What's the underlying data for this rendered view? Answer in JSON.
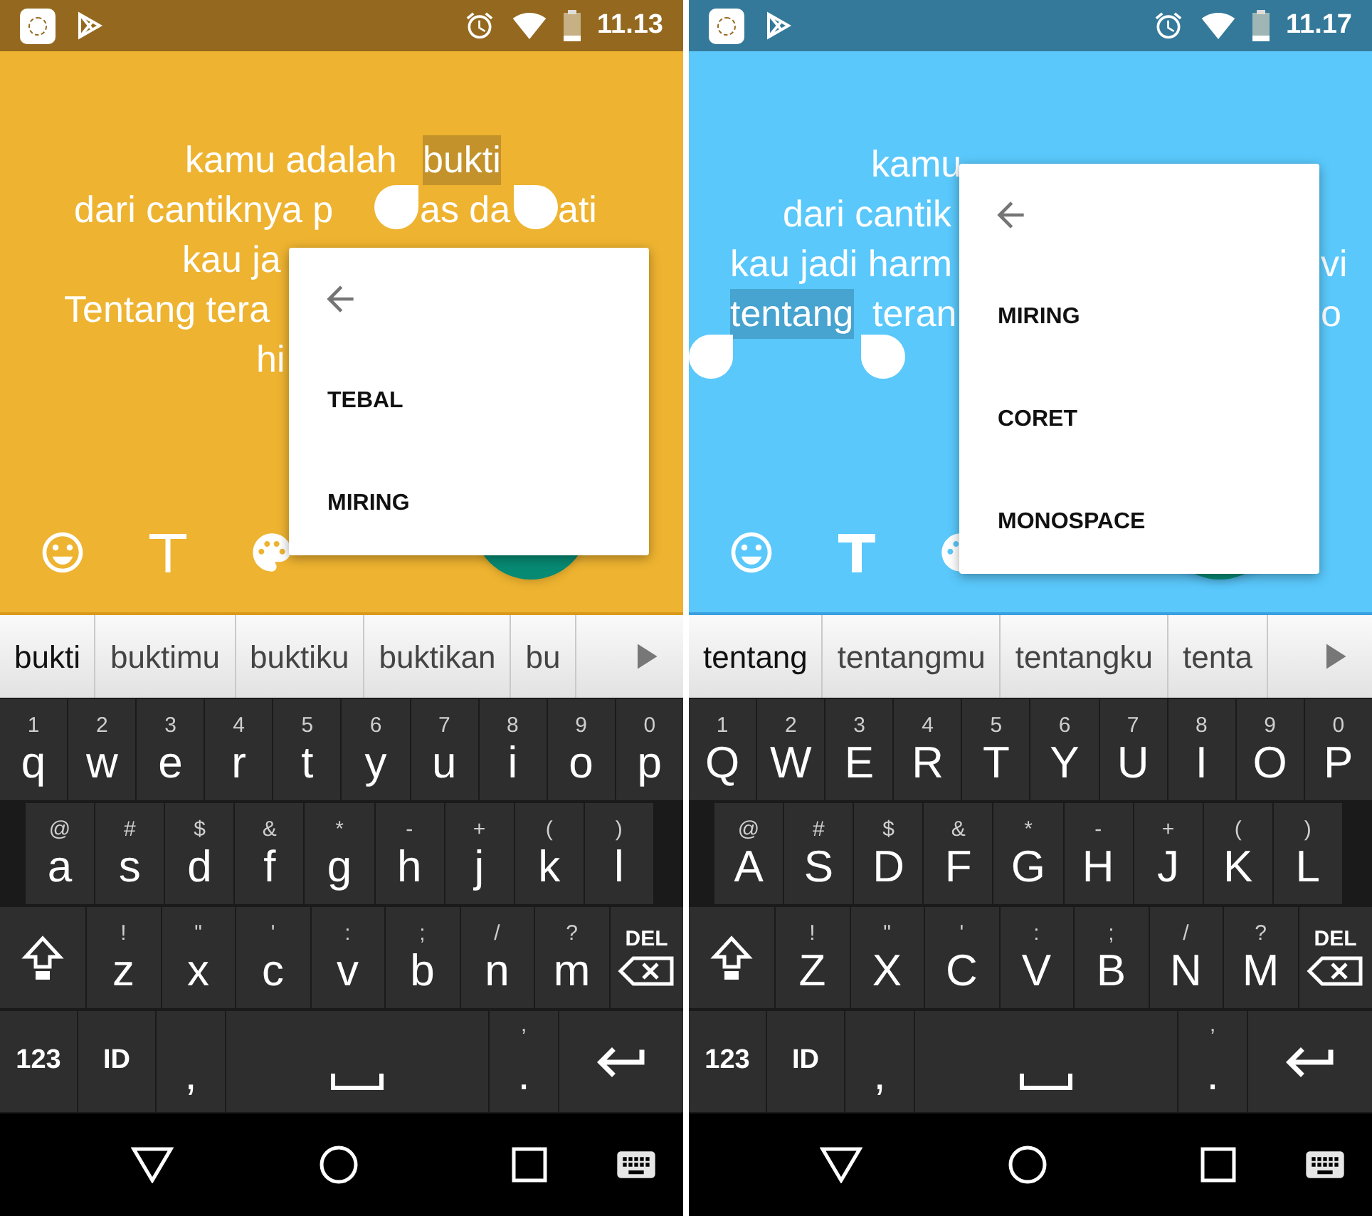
{
  "phones": [
    {
      "kind": "amber",
      "status": {
        "time": "11.13"
      },
      "message_lines": [
        {
          "parts": [
            {
              "text": "kamu adalah",
              "selected": false
            },
            {
              "text": "bukti",
              "selected": true
            }
          ]
        },
        {
          "parts": [
            {
              "text": "dari cantiknya p",
              "selected": false
            },
            {
              "text": "as da",
              "selected": false
            },
            {
              "text": "ati",
              "selected": false
            }
          ]
        },
        {
          "parts": [
            {
              "text": "kau ja",
              "selected": false
            }
          ]
        },
        {
          "parts": [
            {
              "text": "Tentang tera",
              "selected": false
            }
          ]
        },
        {
          "parts": [
            {
              "text": "hi",
              "selected": false
            }
          ]
        }
      ],
      "style_menu": {
        "items": [
          {
            "label": "TEBAL"
          },
          {
            "label": "MIRING"
          }
        ]
      },
      "toolbar": {
        "text_icon_bold": false
      },
      "suggestions": [
        {
          "text": "bukti",
          "selected": true
        },
        {
          "text": "buktimu",
          "selected": false
        },
        {
          "text": "buktiku",
          "selected": false
        },
        {
          "text": "buktikan",
          "selected": false
        },
        {
          "text": "bu",
          "selected": false
        }
      ],
      "keyboard": [
        [
          {
            "kind": "char",
            "label": "q",
            "alt": "1"
          },
          {
            "kind": "char",
            "label": "w",
            "alt": "2"
          },
          {
            "kind": "char",
            "label": "e",
            "alt": "3"
          },
          {
            "kind": "char",
            "label": "r",
            "alt": "4"
          },
          {
            "kind": "char",
            "label": "t",
            "alt": "5"
          },
          {
            "kind": "char",
            "label": "y",
            "alt": "6"
          },
          {
            "kind": "char",
            "label": "u",
            "alt": "7"
          },
          {
            "kind": "char",
            "label": "i",
            "alt": "8"
          },
          {
            "kind": "char",
            "label": "o",
            "alt": "9"
          },
          {
            "kind": "char",
            "label": "p",
            "alt": "0"
          }
        ],
        [
          {
            "kind": "char",
            "label": "a",
            "alt": "@"
          },
          {
            "kind": "char",
            "label": "s",
            "alt": "#"
          },
          {
            "kind": "char",
            "label": "d",
            "alt": "$"
          },
          {
            "kind": "char",
            "label": "f",
            "alt": "&"
          },
          {
            "kind": "char",
            "label": "g",
            "alt": "*"
          },
          {
            "kind": "char",
            "label": "h",
            "alt": "-"
          },
          {
            "kind": "char",
            "label": "j",
            "alt": "+"
          },
          {
            "kind": "char",
            "label": "k",
            "alt": "("
          },
          {
            "kind": "char",
            "label": "l",
            "alt": ")"
          }
        ],
        [
          {
            "kind": "shift"
          },
          {
            "kind": "char",
            "label": "z",
            "alt": "!"
          },
          {
            "kind": "char",
            "label": "x",
            "alt": "\""
          },
          {
            "kind": "char",
            "label": "c",
            "alt": "'"
          },
          {
            "kind": "char",
            "label": "v",
            "alt": ":"
          },
          {
            "kind": "char",
            "label": "b",
            "alt": ";"
          },
          {
            "kind": "char",
            "label": "n",
            "alt": "/"
          },
          {
            "kind": "char",
            "label": "m",
            "alt": "?"
          },
          {
            "kind": "del",
            "label": "DEL"
          }
        ],
        [
          {
            "kind": "label",
            "label": "123"
          },
          {
            "kind": "label",
            "label": "ID"
          },
          {
            "kind": "char",
            "label": ","
          },
          {
            "kind": "space"
          },
          {
            "kind": "char",
            "label": ".",
            "alt": "’"
          },
          {
            "kind": "enter"
          }
        ]
      ]
    },
    {
      "kind": "sky",
      "status": {
        "time": "11.17"
      },
      "message_lines": [
        {
          "parts": [
            {
              "text": "kamu",
              "selected": false
            }
          ]
        },
        {
          "parts": [
            {
              "text": "dari cantik",
              "selected": false
            }
          ]
        },
        {
          "parts": [
            {
              "text": "kau jadi harm",
              "selected": false
            },
            {
              "text": "vi",
              "selected": false
            }
          ]
        },
        {
          "parts": [
            {
              "text": "tentang",
              "selected": true
            },
            {
              "text": "teran",
              "selected": false
            },
            {
              "text": "o",
              "selected": false
            }
          ]
        }
      ],
      "style_menu": {
        "items": [
          {
            "label": "MIRING"
          },
          {
            "label": "CORET"
          },
          {
            "label": "MONOSPACE"
          }
        ]
      },
      "toolbar": {
        "text_icon_bold": true
      },
      "suggestions": [
        {
          "text": "tentang",
          "selected": true
        },
        {
          "text": "tentangmu",
          "selected": false
        },
        {
          "text": "tentangku",
          "selected": false
        },
        {
          "text": "tenta",
          "selected": false
        }
      ],
      "keyboard": [
        [
          {
            "kind": "char",
            "label": "Q",
            "alt": "1"
          },
          {
            "kind": "char",
            "label": "W",
            "alt": "2"
          },
          {
            "kind": "char",
            "label": "E",
            "alt": "3"
          },
          {
            "kind": "char",
            "label": "R",
            "alt": "4"
          },
          {
            "kind": "char",
            "label": "T",
            "alt": "5"
          },
          {
            "kind": "char",
            "label": "Y",
            "alt": "6"
          },
          {
            "kind": "char",
            "label": "U",
            "alt": "7"
          },
          {
            "kind": "char",
            "label": "I",
            "alt": "8"
          },
          {
            "kind": "char",
            "label": "O",
            "alt": "9"
          },
          {
            "kind": "char",
            "label": "P",
            "alt": "0"
          }
        ],
        [
          {
            "kind": "char",
            "label": "A",
            "alt": "@"
          },
          {
            "kind": "char",
            "label": "S",
            "alt": "#"
          },
          {
            "kind": "char",
            "label": "D",
            "alt": "$"
          },
          {
            "kind": "char",
            "label": "F",
            "alt": "&"
          },
          {
            "kind": "char",
            "label": "G",
            "alt": "*"
          },
          {
            "kind": "char",
            "label": "H",
            "alt": "-"
          },
          {
            "kind": "char",
            "label": "J",
            "alt": "+"
          },
          {
            "kind": "char",
            "label": "K",
            "alt": "("
          },
          {
            "kind": "char",
            "label": "L",
            "alt": ")"
          }
        ],
        [
          {
            "kind": "shift"
          },
          {
            "kind": "char",
            "label": "Z",
            "alt": "!"
          },
          {
            "kind": "char",
            "label": "X",
            "alt": "\""
          },
          {
            "kind": "char",
            "label": "C",
            "alt": "'"
          },
          {
            "kind": "char",
            "label": "V",
            "alt": ":"
          },
          {
            "kind": "char",
            "label": "B",
            "alt": ";"
          },
          {
            "kind": "char",
            "label": "N",
            "alt": "/"
          },
          {
            "kind": "char",
            "label": "M",
            "alt": "?"
          },
          {
            "kind": "del",
            "label": "DEL"
          }
        ],
        [
          {
            "kind": "label",
            "label": "123"
          },
          {
            "kind": "label",
            "label": "ID"
          },
          {
            "kind": "char",
            "label": ","
          },
          {
            "kind": "space"
          },
          {
            "kind": "char",
            "label": ".",
            "alt": "’"
          },
          {
            "kind": "enter"
          }
        ]
      ]
    }
  ]
}
